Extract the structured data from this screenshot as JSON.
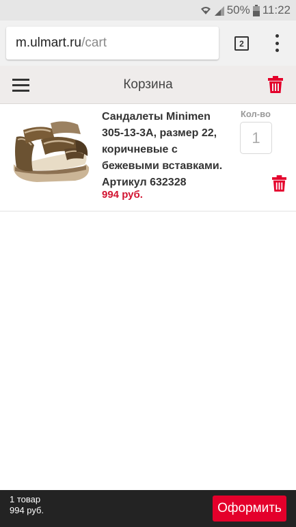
{
  "status_bar": {
    "battery_percent": "50%",
    "time": "11:22",
    "icons": [
      "wifi-icon",
      "signal-icon",
      "battery-icon"
    ]
  },
  "browser": {
    "url_host": "m.ulmart.ru",
    "url_path": "/cart",
    "tab_count": "2",
    "menu_icon": "overflow-menu-icon"
  },
  "header": {
    "title": "Корзина",
    "menu_icon": "hamburger-icon",
    "clear_icon": "trash-icon"
  },
  "cart": {
    "items": [
      {
        "title": "Сандалеты Minimen 305-13-3А, размер 22, коричневые с бежевыми вставками. Артикул 632328",
        "price": "994 руб.",
        "qty_label": "Кол-во",
        "quantity": "1",
        "image_icon": "sandal-image"
      }
    ]
  },
  "summary": {
    "count": "1 товар",
    "total": "994 руб.",
    "checkout_label": "Оформить"
  },
  "colors": {
    "accent": "#e4002b",
    "price": "#d21431",
    "bottom_bar": "#232323",
    "header_bg": "#efeceb"
  }
}
